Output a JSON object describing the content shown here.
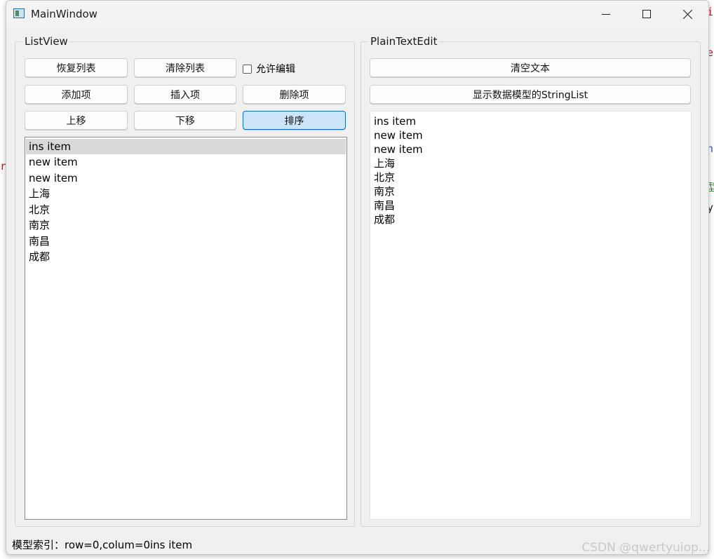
{
  "window": {
    "title": "MainWindow"
  },
  "listview_group": {
    "title": "ListView",
    "buttons": {
      "restore": "恢复列表",
      "clear": "清除列表",
      "allow_edit": "允许编辑",
      "add": "添加项",
      "insert": "插入项",
      "delete": "删除项",
      "move_up": "上移",
      "move_down": "下移",
      "sort": "排序"
    },
    "items": [
      "ins item",
      "new item",
      "new item",
      "上海",
      "北京",
      "南京",
      "南昌",
      "成都"
    ],
    "selected_index": 0
  },
  "textedit_group": {
    "title": "PlainTextEdit",
    "buttons": {
      "clear_text": "清空文本",
      "show_model": "显示数据模型的StringList"
    },
    "lines": [
      "ins item",
      "new item",
      "new item",
      "上海",
      "北京",
      "南京",
      "南昌",
      "成都"
    ]
  },
  "status": {
    "text": "模型索引：row=0,colum=0ins item"
  },
  "watermark": "CSDN @qwertyuiop..."
}
